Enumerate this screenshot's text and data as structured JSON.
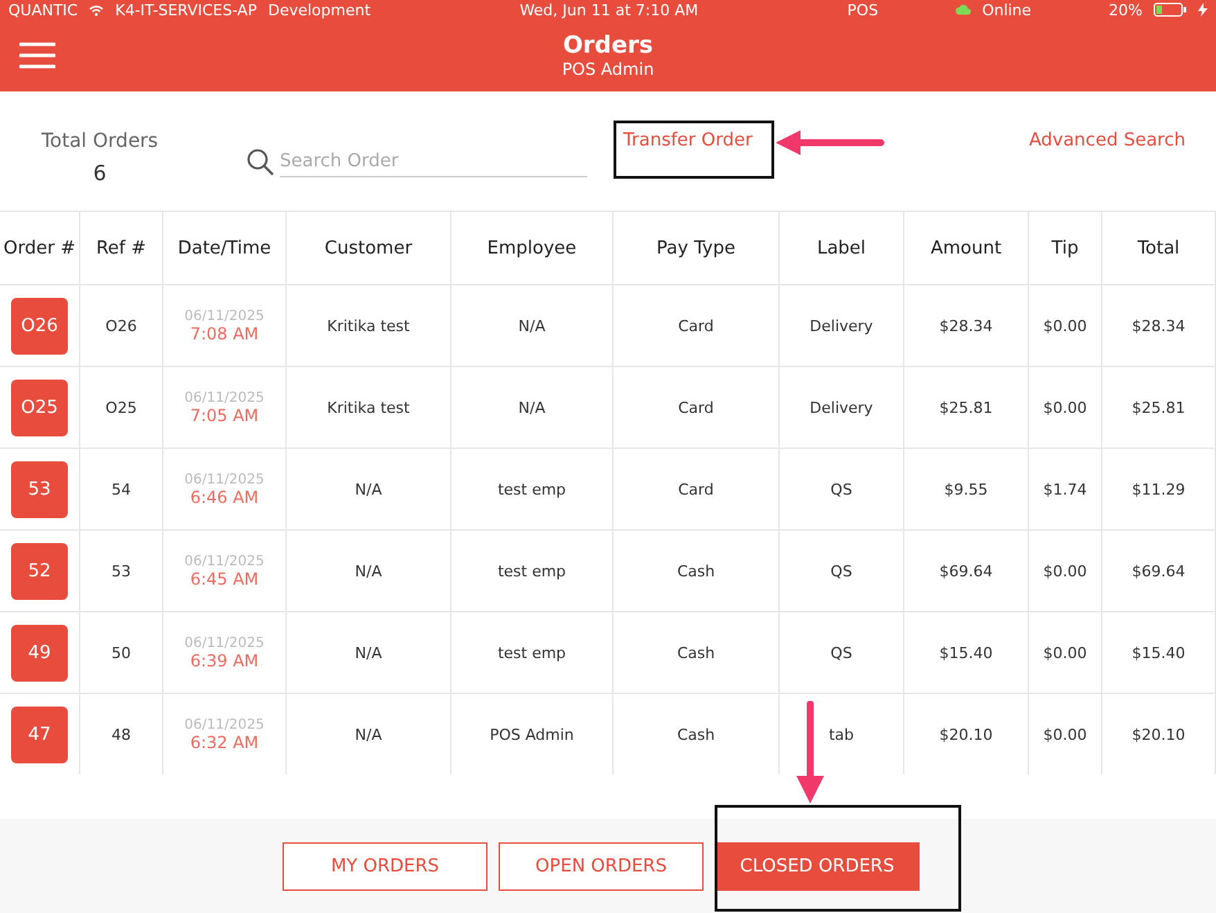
{
  "status_bar": {
    "brand": "QUANTIC",
    "network": "K4-IT-SERVICES-AP",
    "environment": "Development",
    "datetime": "Wed, Jun 11 at 7:10 AM",
    "app": "POS",
    "connection": "Online",
    "battery": "20%"
  },
  "header": {
    "title": "Orders",
    "subtitle": "POS Admin"
  },
  "summary": {
    "label": "Total Orders",
    "count": "6"
  },
  "search": {
    "placeholder": "Search Order"
  },
  "links": [
    "Transfer Order",
    "Advanced Search"
  ],
  "table": {
    "columns": [
      "Order #",
      "Ref #",
      "Date/Time",
      "Customer",
      "Employee",
      "Pay Type",
      "Label",
      "Amount",
      "Tip",
      "Total"
    ],
    "rows": [
      {
        "order": "O26",
        "ref": "O26",
        "date": "06/11/2025",
        "time": "7:08 AM",
        "customer": "Kritika test",
        "employee": "N/A",
        "pay_type": "Card",
        "label": "Delivery",
        "amount": "$28.34",
        "tip": "$0.00",
        "total": "$28.34"
      },
      {
        "order": "O25",
        "ref": "O25",
        "date": "06/11/2025",
        "time": "7:05 AM",
        "customer": "Kritika test",
        "employee": "N/A",
        "pay_type": "Card",
        "label": "Delivery",
        "amount": "$25.81",
        "tip": "$0.00",
        "total": "$25.81"
      },
      {
        "order": "53",
        "ref": "54",
        "date": "06/11/2025",
        "time": "6:46 AM",
        "customer": "N/A",
        "employee": "test emp",
        "pay_type": "Card",
        "label": "QS",
        "amount": "$9.55",
        "tip": "$1.74",
        "total": "$11.29"
      },
      {
        "order": "52",
        "ref": "53",
        "date": "06/11/2025",
        "time": "6:45 AM",
        "customer": "N/A",
        "employee": "test emp",
        "pay_type": "Cash",
        "label": "QS",
        "amount": "$69.64",
        "tip": "$0.00",
        "total": "$69.64"
      },
      {
        "order": "49",
        "ref": "50",
        "date": "06/11/2025",
        "time": "6:39 AM",
        "customer": "N/A",
        "employee": "test emp",
        "pay_type": "Cash",
        "label": "QS",
        "amount": "$15.40",
        "tip": "$0.00",
        "total": "$15.40"
      },
      {
        "order": "47",
        "ref": "48",
        "date": "06/11/2025",
        "time": "6:32 AM",
        "customer": "N/A",
        "employee": "POS Admin",
        "pay_type": "Cash",
        "label": "tab",
        "amount": "$20.10",
        "tip": "$0.00",
        "total": "$20.10"
      }
    ]
  },
  "footer_buttons": [
    {
      "label": "MY ORDERS",
      "selected": false
    },
    {
      "label": "OPEN ORDERS",
      "selected": false
    },
    {
      "label": "CLOSED ORDERS",
      "selected": true
    }
  ]
}
